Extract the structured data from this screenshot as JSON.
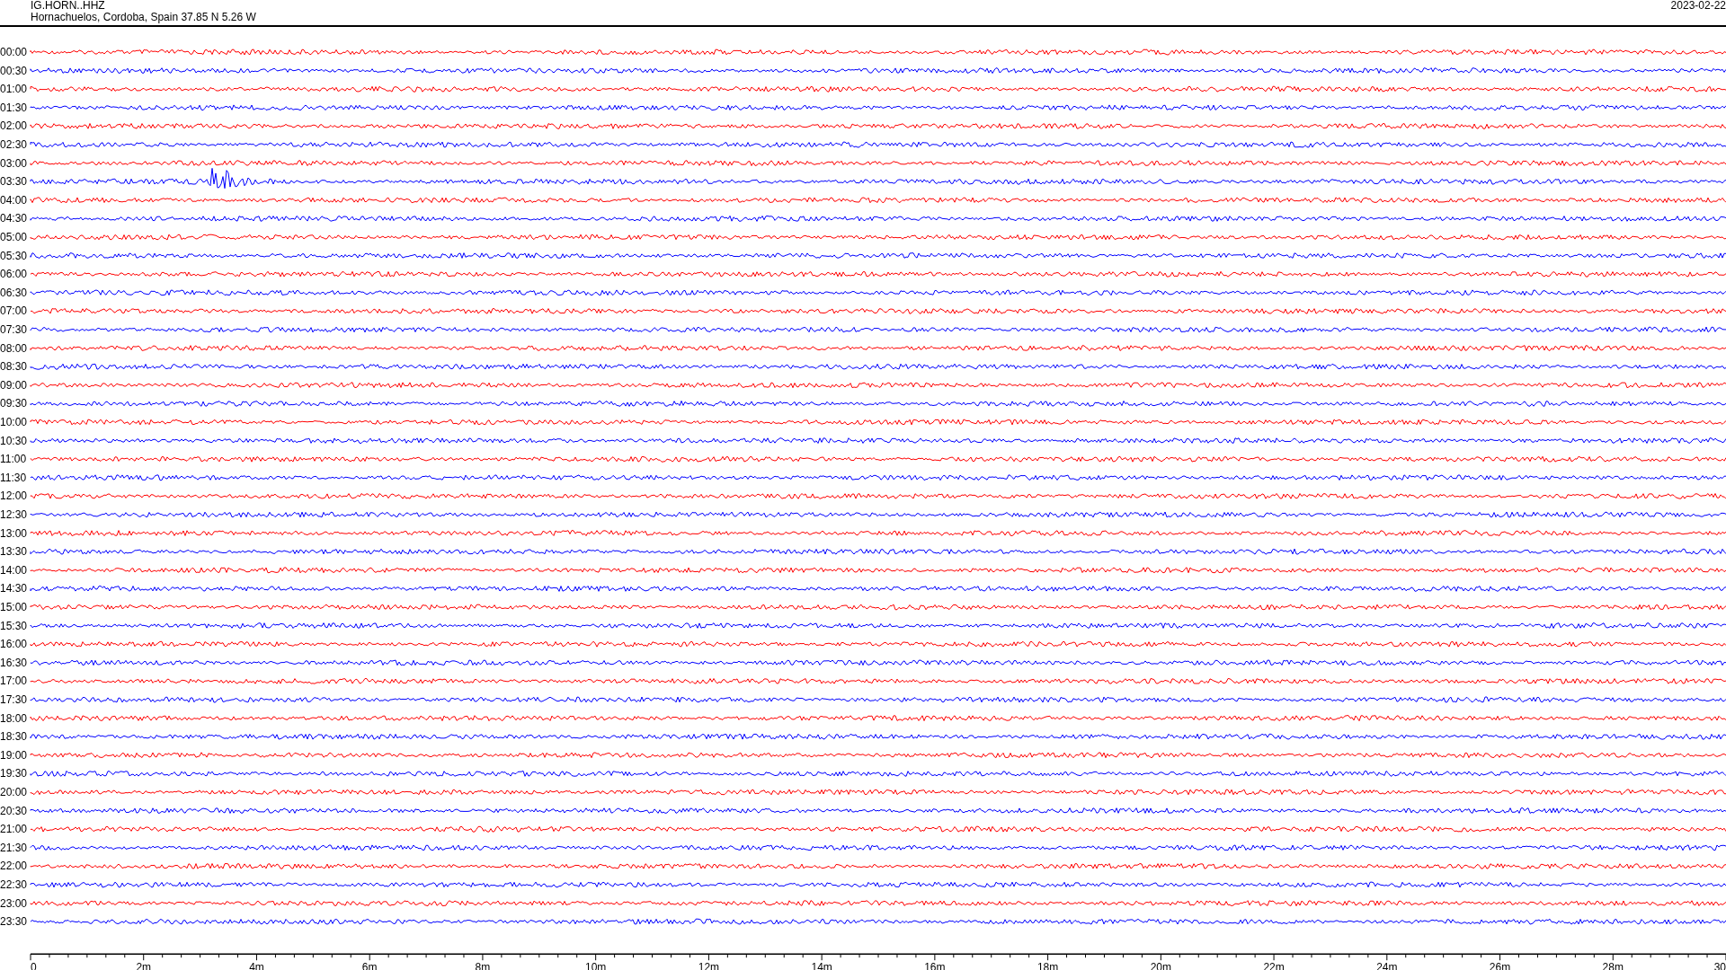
{
  "header": {
    "station": "IG.HORN..HHZ",
    "location": "Hornachuelos, Cordoba, Spain  37.85 N 5.26 W",
    "date": "2023-02-22"
  },
  "traces": [
    {
      "label": "00:00",
      "color": "#ff0000"
    },
    {
      "label": "00:30",
      "color": "#0000ff"
    },
    {
      "label": "01:00",
      "color": "#ff0000"
    },
    {
      "label": "01:30",
      "color": "#0000ff"
    },
    {
      "label": "02:00",
      "color": "#ff0000"
    },
    {
      "label": "02:30",
      "color": "#0000ff"
    },
    {
      "label": "03:00",
      "color": "#ff0000"
    },
    {
      "label": "03:30",
      "color": "#0000ff"
    },
    {
      "label": "04:00",
      "color": "#ff0000"
    },
    {
      "label": "04:30",
      "color": "#0000ff"
    },
    {
      "label": "05:00",
      "color": "#ff0000"
    },
    {
      "label": "05:30",
      "color": "#0000ff"
    },
    {
      "label": "06:00",
      "color": "#ff0000"
    },
    {
      "label": "06:30",
      "color": "#0000ff"
    },
    {
      "label": "07:00",
      "color": "#ff0000"
    },
    {
      "label": "07:30",
      "color": "#0000ff"
    },
    {
      "label": "08:00",
      "color": "#ff0000"
    },
    {
      "label": "08:30",
      "color": "#0000ff"
    },
    {
      "label": "09:00",
      "color": "#ff0000"
    },
    {
      "label": "09:30",
      "color": "#0000ff"
    },
    {
      "label": "10:00",
      "color": "#ff0000"
    },
    {
      "label": "10:30",
      "color": "#0000ff"
    },
    {
      "label": "11:00",
      "color": "#ff0000"
    },
    {
      "label": "11:30",
      "color": "#0000ff"
    },
    {
      "label": "12:00",
      "color": "#ff0000"
    },
    {
      "label": "12:30",
      "color": "#0000ff"
    },
    {
      "label": "13:00",
      "color": "#ff0000"
    },
    {
      "label": "13:30",
      "color": "#0000ff"
    },
    {
      "label": "14:00",
      "color": "#ff0000"
    },
    {
      "label": "14:30",
      "color": "#0000ff"
    },
    {
      "label": "15:00",
      "color": "#ff0000"
    },
    {
      "label": "15:30",
      "color": "#0000ff"
    },
    {
      "label": "16:00",
      "color": "#ff0000"
    },
    {
      "label": "16:30",
      "color": "#0000ff"
    },
    {
      "label": "17:00",
      "color": "#ff0000"
    },
    {
      "label": "17:30",
      "color": "#0000ff"
    },
    {
      "label": "18:00",
      "color": "#ff0000"
    },
    {
      "label": "18:30",
      "color": "#0000ff"
    },
    {
      "label": "19:00",
      "color": "#ff0000"
    },
    {
      "label": "19:30",
      "color": "#0000ff"
    },
    {
      "label": "20:00",
      "color": "#ff0000"
    },
    {
      "label": "20:30",
      "color": "#0000ff"
    },
    {
      "label": "21:00",
      "color": "#ff0000"
    },
    {
      "label": "21:30",
      "color": "#0000ff"
    },
    {
      "label": "22:00",
      "color": "#ff0000"
    },
    {
      "label": "22:30",
      "color": "#0000ff"
    },
    {
      "label": "23:00",
      "color": "#ff0000"
    },
    {
      "label": "23:30",
      "color": "#0000ff"
    }
  ],
  "time_axis": {
    "ticks": [
      "0",
      "2m",
      "4m",
      "6m",
      "8m",
      "10m",
      "12m",
      "14m",
      "16m",
      "18m",
      "20m",
      "22m",
      "24m",
      "26m",
      "28m",
      "30"
    ]
  }
}
